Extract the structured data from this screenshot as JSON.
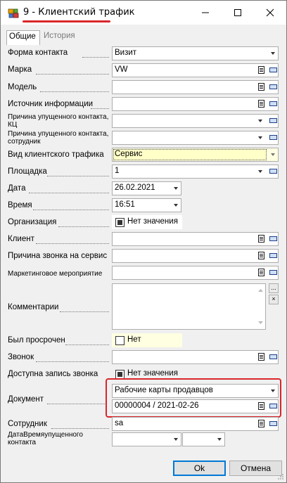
{
  "window": {
    "title": "9 - Клиентский трафик",
    "minimize_label": "Свернуть",
    "maximize_label": "Развернуть",
    "close_label": "Закрыть"
  },
  "tabs": [
    {
      "label": "Общие",
      "active": true
    },
    {
      "label": "История",
      "active": false
    }
  ],
  "fields": {
    "contact_form": {
      "label": "Форма контакта",
      "value": "Визит"
    },
    "brand": {
      "label": "Марка",
      "value": "VW"
    },
    "model": {
      "label": "Модель",
      "value": ""
    },
    "info_source": {
      "label": "Источник информации",
      "value": ""
    },
    "missed_reason_cc": {
      "label": "Причина упущенного контакта, КЦ",
      "value": ""
    },
    "missed_reason_emp": {
      "label": "Причина упущенного контакта, сотрудник",
      "value": ""
    },
    "traffic_type": {
      "label": "Вид клиентского трафика",
      "value": "Сервис"
    },
    "site": {
      "label": "Площадка",
      "value": "1"
    },
    "date": {
      "label": "Дата",
      "value": "26.02.2021"
    },
    "time": {
      "label": "Время",
      "value": "16:51"
    },
    "organization": {
      "label": "Организация",
      "value": "Нет значения"
    },
    "client": {
      "label": "Клиент",
      "value": ""
    },
    "service_call_reason": {
      "label": "Причина звонка на сервис",
      "value": ""
    },
    "marketing_event": {
      "label": "Маркетинговое мероприятие",
      "value": ""
    },
    "comments": {
      "label": "Комментарии",
      "value": "",
      "more_btn": "...",
      "clear_btn": "×"
    },
    "overdue": {
      "label": "Был просрочен",
      "value": "Нет"
    },
    "call": {
      "label": "Звонок",
      "value": ""
    },
    "call_recording": {
      "label": "Доступна запись звонка",
      "value": "Нет значения"
    },
    "document": {
      "label": "Документ",
      "type_value": "Рабочие карты продавцов",
      "value": "00000004 / 2021-02-26"
    },
    "employee": {
      "label": "Сотрудник",
      "value": "sa"
    },
    "missed_datetime": {
      "label": "ДатаВремяупущенного контакта",
      "value": ""
    }
  },
  "buttons": {
    "ok": "Ok",
    "cancel": "Отмена"
  },
  "colors": {
    "accent_red": "#d8262a",
    "highlight_yellow": "#ffffe1",
    "focus_blue": "#0078d7"
  }
}
